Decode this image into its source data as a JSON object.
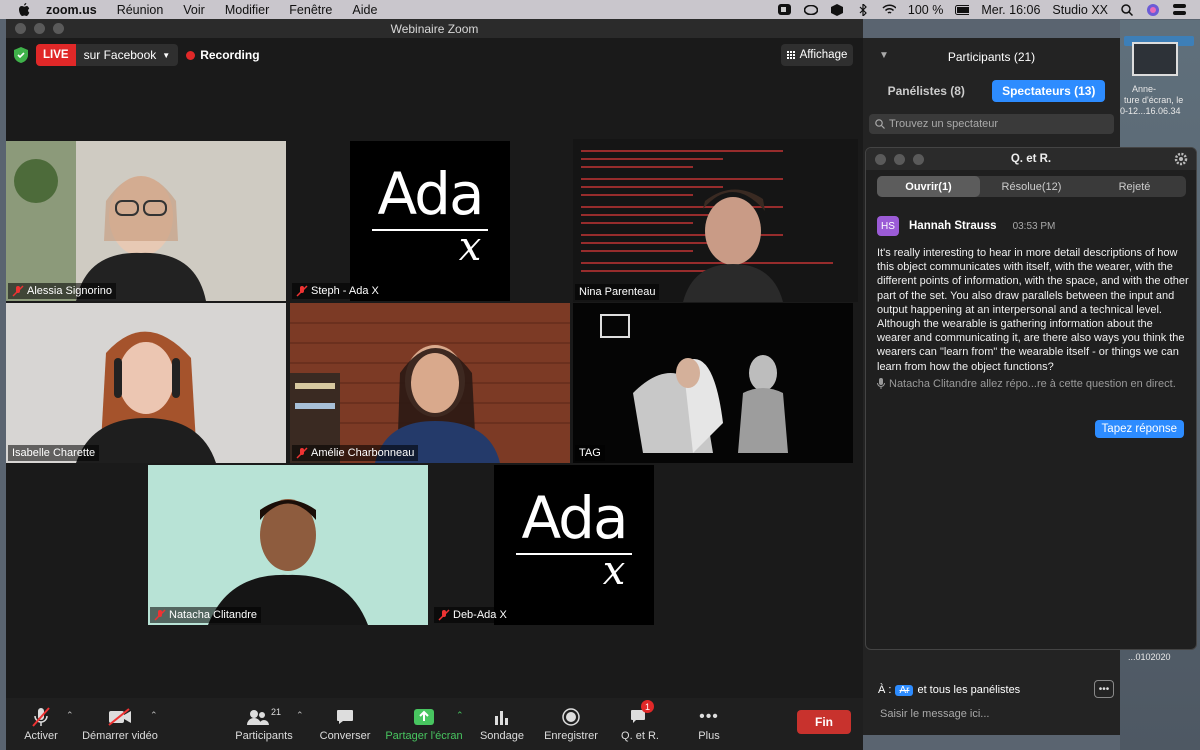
{
  "menubar": {
    "app": "zoom.us",
    "items": [
      "Réunion",
      "Voir",
      "Modifier",
      "Fenêtre",
      "Aide"
    ],
    "battery": "100 %",
    "clock": "Mer. 16:06",
    "user": "Studio XX"
  },
  "desktop": {
    "captions": [
      "Anne-",
      "ture d'écran, le",
      "0-12...16.06.34",
      "...0102020"
    ]
  },
  "window": {
    "title": "Webinaire Zoom"
  },
  "topbar": {
    "live": "LIVE",
    "stream_target": "sur Facebook",
    "recording": "Recording",
    "view": "Affichage"
  },
  "tiles": [
    {
      "name": "Alessia Signorino",
      "muted": true
    },
    {
      "name": "Steph - Ada X",
      "muted": true
    },
    {
      "name": "Nina Parenteau",
      "muted": false,
      "active": true
    },
    {
      "name": "Isabelle Charette",
      "muted": false
    },
    {
      "name": "Amélie Charbonneau",
      "muted": true
    },
    {
      "name": "TAG",
      "muted": false
    },
    {
      "name": "Natacha Clitandre",
      "muted": true
    },
    {
      "name": "Deb-Ada X",
      "muted": true
    }
  ],
  "logo": {
    "text": "Ada",
    "mark": "x"
  },
  "toolbar": {
    "mute": "Activer",
    "video": "Démarrer vidéo",
    "participants": "Participants",
    "participants_count": "21",
    "chat": "Converser",
    "share": "Partager l'écran",
    "poll": "Sondage",
    "record": "Enregistrer",
    "qa": "Q. et R.",
    "qa_badge": "1",
    "more": "Plus",
    "end": "Fin"
  },
  "participants_panel": {
    "title": "Participants (21)",
    "tab_panelists": "Panélistes (8)",
    "tab_attendees": "Spectateurs (13)",
    "search_placeholder": "Trouvez un spectateur"
  },
  "chat": {
    "to_label": "À :",
    "recipient": "Ar",
    "recipient_rest": "et tous les panélistes",
    "input_placeholder": "Saisir le message ici..."
  },
  "qa": {
    "title": "Q. et R.",
    "tabs": [
      "Ouvrir(1)",
      "Résolue(12)",
      "Rejeté"
    ],
    "question": {
      "initials": "HS",
      "author": "Hannah Strauss",
      "time": "03:53 PM",
      "text": "It's really interesting to hear in more detail descriptions of how this object communicates with itself, with the wearer, with the different points of information, with the space, and with the other part of the set. You also draw parallels between the input and output happening at an interpersonal and a technical level. Although the wearable is gathering information about the wearer and communicating it, are there also ways you think the wearers can \"learn from\" the wearable itself - or things we can learn from how the object functions?",
      "answering": "Natacha Clitandre allez répo...re à cette question en direct."
    },
    "reply_button": "Tapez réponse"
  },
  "colors": {
    "accent": "#2d8cff",
    "live": "#e02828",
    "share": "#48c560",
    "active_speaker": "#d8dc7a"
  }
}
